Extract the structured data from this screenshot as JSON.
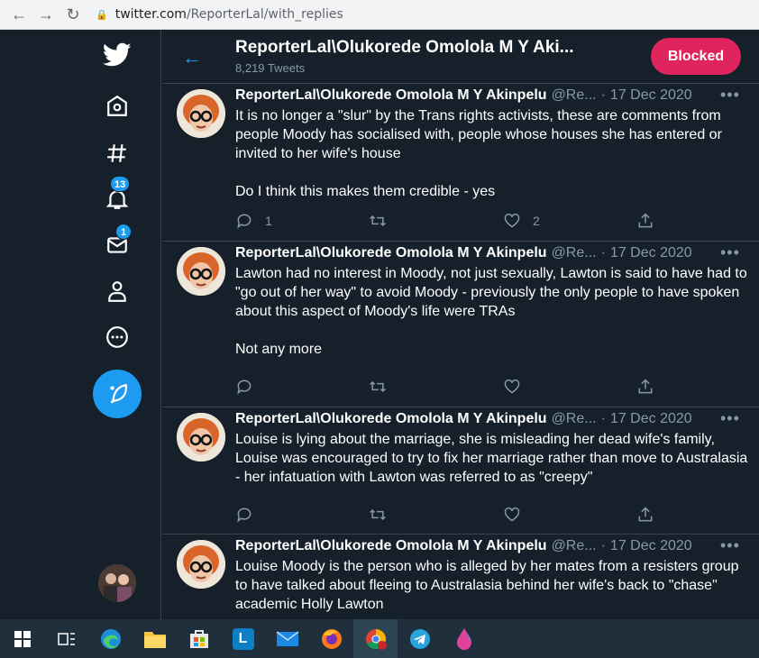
{
  "browser": {
    "url_host": "twitter.com",
    "url_path": "/ReporterLal/with_replies"
  },
  "sidebar": {
    "notifications_count": "13",
    "messages_count": "1"
  },
  "header": {
    "title": "ReporterLal\\Olukorede Omolola M Y Aki...",
    "tweet_count": "8,219 Tweets",
    "blocked_label": "Blocked"
  },
  "tweets": [
    {
      "name": "ReporterLal\\Olukorede Omolola M Y Akinpelu",
      "handle": "@Re...",
      "date": "17 Dec 2020",
      "text": "It is no longer a \"slur\" by the Trans rights activists, these are comments from people Moody has socialised with, people whose houses she has entered or invited to her wife's house\n\nDo I think this makes them credible - yes",
      "replies": "1",
      "retweets": "",
      "likes": "2"
    },
    {
      "name": "ReporterLal\\Olukorede Omolola M Y Akinpelu",
      "handle": "@Re...",
      "date": "17 Dec 2020",
      "text": "Lawton had no interest in Moody, not just sexually, Lawton is said to have had to \"go out of her way\" to avoid Moody - previously the only people to have spoken about this aspect of Moody's life were TRAs\n\nNot any more",
      "replies": "",
      "retweets": "",
      "likes": ""
    },
    {
      "name": "ReporterLal\\Olukorede Omolola M Y Akinpelu",
      "handle": "@Re...",
      "date": "17 Dec 2020",
      "text": "Louise is lying about the marriage, she is misleading her dead wife's family, Louise was encouraged to try to fix her marriage rather than move to Australasia - her infatuation with Lawton was referred to as \"creepy\"",
      "replies": "",
      "retweets": "",
      "likes": ""
    },
    {
      "name": "ReporterLal\\Olukorede Omolola M Y Akinpelu",
      "handle": "@Re...",
      "date": "17 Dec 2020",
      "text": "Louise Moody is the person who is alleged by her mates from a resisters group to have talked about fleeing to Australasia behind her wife's back to \"chase\" academic Holly Lawton",
      "replies": "",
      "retweets": "",
      "likes": ""
    }
  ],
  "taskbar": {
    "pinned_letter": "L"
  }
}
